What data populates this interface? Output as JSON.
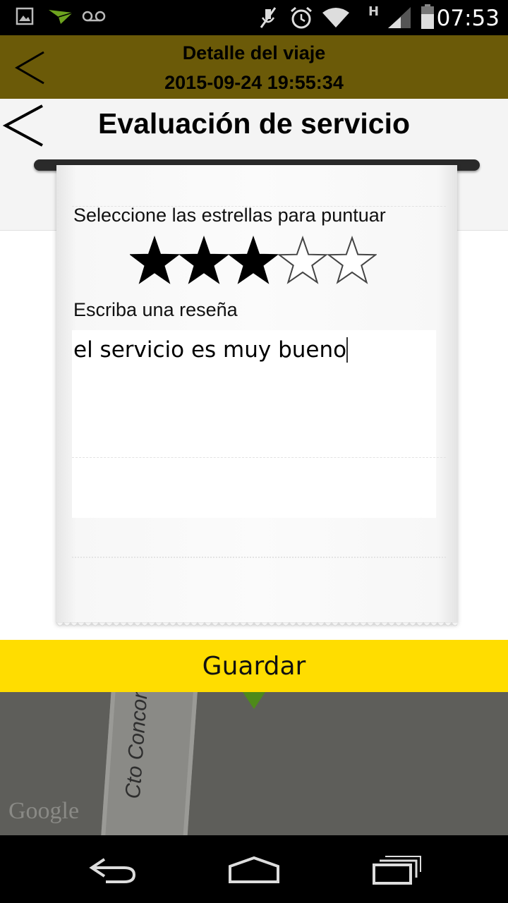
{
  "status_bar": {
    "time": "07:53",
    "network_type": "H",
    "icons": [
      "picture-icon",
      "send-icon",
      "voicemail-icon",
      "mute-icon",
      "alarm-icon",
      "wifi-icon",
      "signal-icon",
      "battery-icon"
    ]
  },
  "trip_header": {
    "title": "Detalle del viaje",
    "datetime": "2015-09-24 19:55:34"
  },
  "dialog": {
    "title": "Evaluación de servicio",
    "stars_label": "Seleccione las estrellas para puntuar",
    "rating": 3,
    "max_rating": 5,
    "review_label": "Escriba una reseña",
    "review_value": "el servicio es muy bueno"
  },
  "save_button": {
    "label": "Guardar",
    "color": "#ffdd00"
  },
  "map": {
    "street_label": "Cto Concor",
    "attribution": "Google"
  },
  "colors": {
    "header_bg": "#6b5a08",
    "accent_yellow": "#ffdd00",
    "marker_green": "#4e8a1a"
  }
}
